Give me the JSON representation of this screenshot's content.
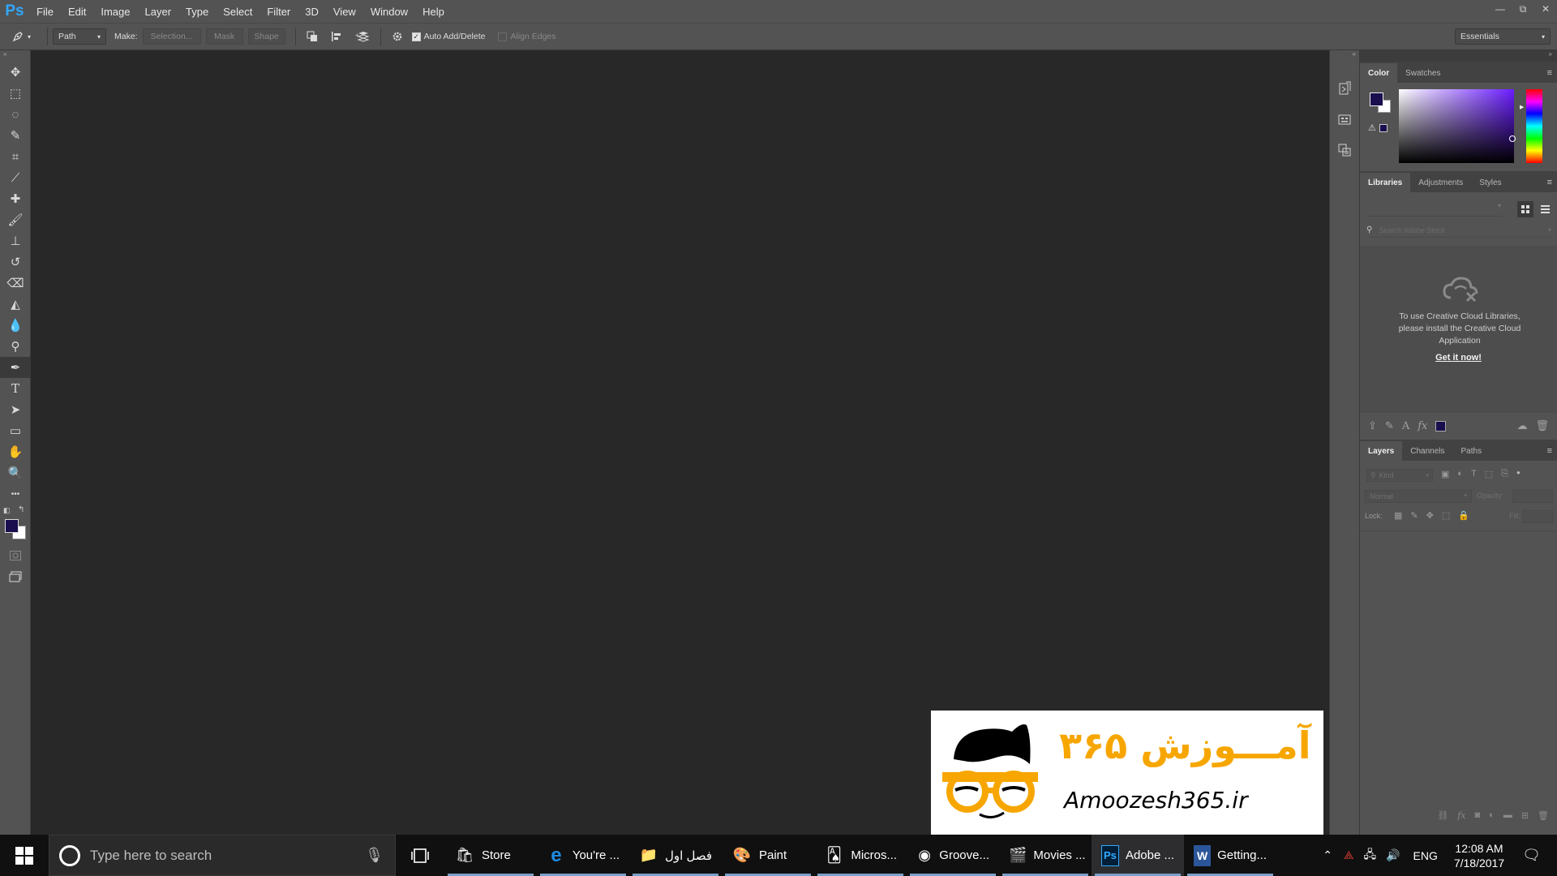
{
  "app": {
    "logo": "Ps"
  },
  "menubar": {
    "items": [
      "File",
      "Edit",
      "Image",
      "Layer",
      "Type",
      "Select",
      "Filter",
      "3D",
      "View",
      "Window",
      "Help"
    ]
  },
  "window_controls": {
    "minimize": "—",
    "restore": "⧉",
    "close": "✕"
  },
  "options": {
    "mode_value": "Path",
    "make_label": "Make:",
    "selection_label": "Selection...",
    "mask_label": "Mask",
    "shape_label": "Shape",
    "auto_add_delete_label": "Auto Add/Delete",
    "auto_add_delete_checked": true,
    "align_edges_label": "Align Edges",
    "align_edges_checked": false,
    "workspace_value": "Essentials"
  },
  "toolbar": {
    "tools": [
      "move-tool",
      "marquee-tool",
      "lasso-tool",
      "quick-selection-tool",
      "crop-tool",
      "eyedropper-tool",
      "healing-brush-tool",
      "brush-tool",
      "clone-stamp-tool",
      "history-brush-tool",
      "eraser-tool",
      "paint-bucket-tool",
      "blur-tool",
      "dodge-tool",
      "pen-tool",
      "type-tool",
      "path-selection-tool",
      "rectangle-tool",
      "hand-tool",
      "zoom-tool",
      "edit-toolbar"
    ],
    "active_tool": "pen-tool",
    "foreground_color": "#1a0e4f",
    "background_color": "#ffffff"
  },
  "color_panel": {
    "tabs": [
      "Color",
      "Swatches"
    ],
    "active_tab": "Color",
    "foreground_color": "#1a0e4f",
    "background_color": "#ffffff",
    "hue_color": "#6a1cff"
  },
  "libraries_panel": {
    "tabs": [
      "Libraries",
      "Adjustments",
      "Styles"
    ],
    "active_tab": "Libraries",
    "search_placeholder": "Search Adobe Stock",
    "message": "To use Creative Cloud Libraries, please install the Creative Cloud Application",
    "link_label": "Get it now!"
  },
  "layers_panel": {
    "tabs": [
      "Layers",
      "Channels",
      "Paths"
    ],
    "active_tab": "Layers",
    "filter_label": "Kind",
    "blend_mode": "Normal",
    "opacity_label": "Opacity:",
    "lock_label": "Lock:",
    "fill_label": "Fill:"
  },
  "taskbar": {
    "search_placeholder": "Type here to search",
    "apps": [
      {
        "label": "Store",
        "icon": "store-icon",
        "open": true,
        "active": false
      },
      {
        "label": "You're ...",
        "icon": "edge-icon",
        "open": true,
        "active": false
      },
      {
        "label": "فصل اول",
        "icon": "folder-icon",
        "open": true,
        "active": false
      },
      {
        "label": "Paint",
        "icon": "paint-icon",
        "open": true,
        "active": false
      },
      {
        "label": "Micros...",
        "icon": "solitaire-icon",
        "open": true,
        "active": false
      },
      {
        "label": "Groove...",
        "icon": "groove-icon",
        "open": true,
        "active": false
      },
      {
        "label": "Movies ...",
        "icon": "movies-icon",
        "open": true,
        "active": false
      },
      {
        "label": "Adobe ...",
        "icon": "photoshop-icon",
        "open": true,
        "active": true
      },
      {
        "label": "Getting...",
        "icon": "word-icon",
        "open": true,
        "active": false
      }
    ],
    "language": "ENG",
    "time": "12:08 AM",
    "date": "7/18/2017"
  },
  "watermark": {
    "persian_text": "آمـــوزش ۳۶۵",
    "site": "Amoozesh365.ir",
    "brand_color": "#f7a600"
  }
}
